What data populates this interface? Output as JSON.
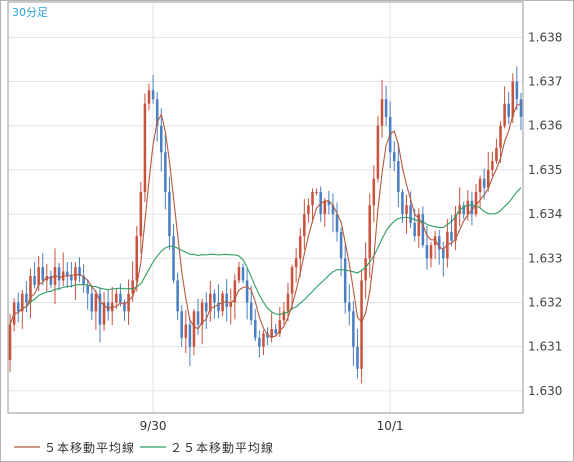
{
  "chart_data": {
    "type": "candlestick",
    "timeframe_label": "30分足",
    "ylim": [
      1.6295,
      1.6388
    ],
    "y_ticks": [
      1.63,
      1.631,
      1.632,
      1.633,
      1.634,
      1.635,
      1.636,
      1.637,
      1.638
    ],
    "y_tick_labels": [
      "1.630",
      "1.631",
      "1.632",
      "1.633",
      "1.634",
      "1.635",
      "1.636",
      "1.637",
      "1.638"
    ],
    "grid": true,
    "x_ticks": [
      {
        "label": "9/30",
        "index": 35
      },
      {
        "label": "10/1",
        "index": 93
      }
    ],
    "legend": {
      "position": "bottom",
      "ma5_label": "５本移動平均線",
      "ma25_label": "２５本移動平均線"
    },
    "colors": {
      "up": "#c9523d",
      "down": "#4a7fc4",
      "ma5": "#b5593f",
      "ma25": "#2f9e62",
      "timeframe": "#2aa0d8",
      "grid": "#e2e2e2",
      "frame": "#999999"
    },
    "close": [
      1.6315,
      1.632,
      1.6318,
      1.6322,
      1.632,
      1.6326,
      1.6324,
      1.6328,
      1.6325,
      1.6326,
      1.6324,
      1.6328,
      1.6325,
      1.6327,
      1.6326,
      1.6325,
      1.6328,
      1.6326,
      1.6324,
      1.6322,
      1.6318,
      1.6322,
      1.6315,
      1.632,
      1.6318,
      1.632,
      1.6322,
      1.632,
      1.6318,
      1.6322,
      1.6325,
      1.6335,
      1.6345,
      1.6365,
      1.6368,
      1.6366,
      1.636,
      1.6354,
      1.6345,
      1.6335,
      1.6325,
      1.6318,
      1.6312,
      1.6315,
      1.631,
      1.6318,
      1.6315,
      1.632,
      1.6318,
      1.6322,
      1.632,
      1.6318,
      1.6322,
      1.6319,
      1.632,
      1.6325,
      1.6328,
      1.6325,
      1.632,
      1.6316,
      1.6312,
      1.631,
      1.6313,
      1.6312,
      1.6314,
      1.6313,
      1.6316,
      1.6318,
      1.6322,
      1.6328,
      1.633,
      1.6335,
      1.634,
      1.6342,
      1.6345,
      1.6345,
      1.634,
      1.6343,
      1.6342,
      1.634,
      1.6336,
      1.633,
      1.632,
      1.6318,
      1.631,
      1.6305,
      1.6325,
      1.633,
      1.6342,
      1.6348,
      1.636,
      1.6366,
      1.6362,
      1.6354,
      1.6352,
      1.6345,
      1.634,
      1.6342,
      1.6338,
      1.6335,
      1.634,
      1.6333,
      1.633,
      1.6333,
      1.6335,
      1.6332,
      1.633,
      1.6336,
      1.6334,
      1.634,
      1.6342,
      1.634,
      1.6343,
      1.634,
      1.6345,
      1.6348,
      1.6346,
      1.635,
      1.6352,
      1.6355,
      1.636,
      1.6365,
      1.6362,
      1.637,
      1.6366,
      1.6362
    ]
  },
  "labels": {
    "timeframe": "30分足",
    "ma5": "５本移動平均線",
    "ma25": "２５本移動平均線"
  }
}
